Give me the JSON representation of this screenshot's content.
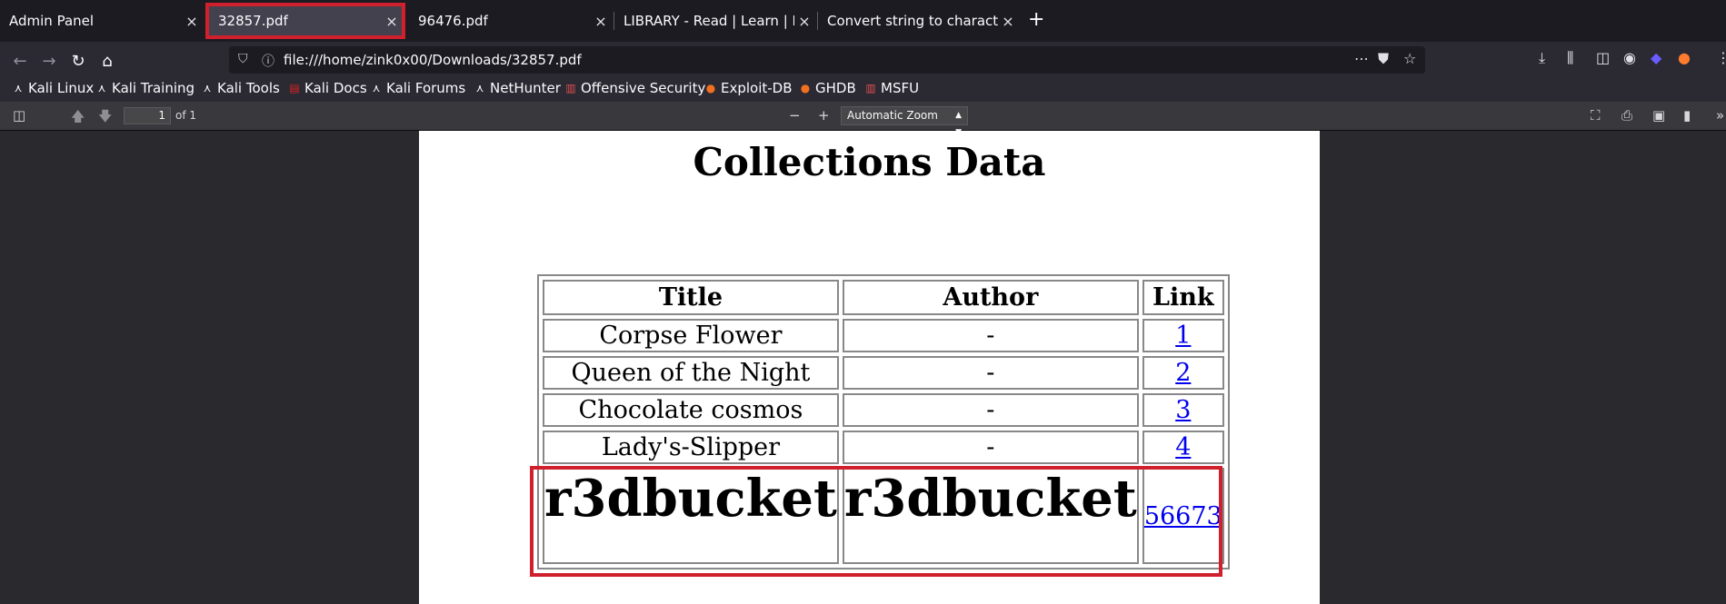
{
  "tabs": [
    {
      "label": "Admin Panel"
    },
    {
      "label": "32857.pdf",
      "active": true
    },
    {
      "label": "96476.pdf"
    },
    {
      "label": "LIBRARY - Read | Learn | Ha"
    },
    {
      "label": "Convert string to character c"
    }
  ],
  "tab_close": "×",
  "new_tab": "+",
  "url": "file:///home/zink0x00/Downloads/32857.pdf",
  "bookmarks": [
    {
      "label": "Kali Linux"
    },
    {
      "label": "Kali Training"
    },
    {
      "label": "Kali Tools"
    },
    {
      "label": "Kali Docs"
    },
    {
      "label": "Kali Forums"
    },
    {
      "label": "NetHunter"
    },
    {
      "label": "Offensive Security"
    },
    {
      "label": "Exploit-DB"
    },
    {
      "label": "GHDB"
    },
    {
      "label": "MSFU"
    }
  ],
  "pdf_toolbar": {
    "page_number": "1",
    "of_pages": "of 1",
    "zoom_out": "−",
    "zoom_in": "+",
    "zoom": "Automatic Zoom"
  },
  "document": {
    "title": "Collections Data",
    "headers": [
      "Title",
      "Author",
      "Link"
    ],
    "rows": [
      {
        "title": "Corpse Flower",
        "author": "-",
        "link": "1"
      },
      {
        "title": "Queen of the Night",
        "author": "-",
        "link": "2"
      },
      {
        "title": "Chocolate cosmos",
        "author": "-",
        "link": "3"
      },
      {
        "title": "Lady's-Slipper",
        "author": "-",
        "link": "4"
      },
      {
        "title": "r3dbucket",
        "author": "r3dbucket",
        "link": "56673"
      }
    ]
  },
  "colors": {
    "highlight": "#d0202e",
    "link": "#0000ee",
    "chrome_dark": "#1c1b22",
    "chrome": "#2b2a33"
  }
}
